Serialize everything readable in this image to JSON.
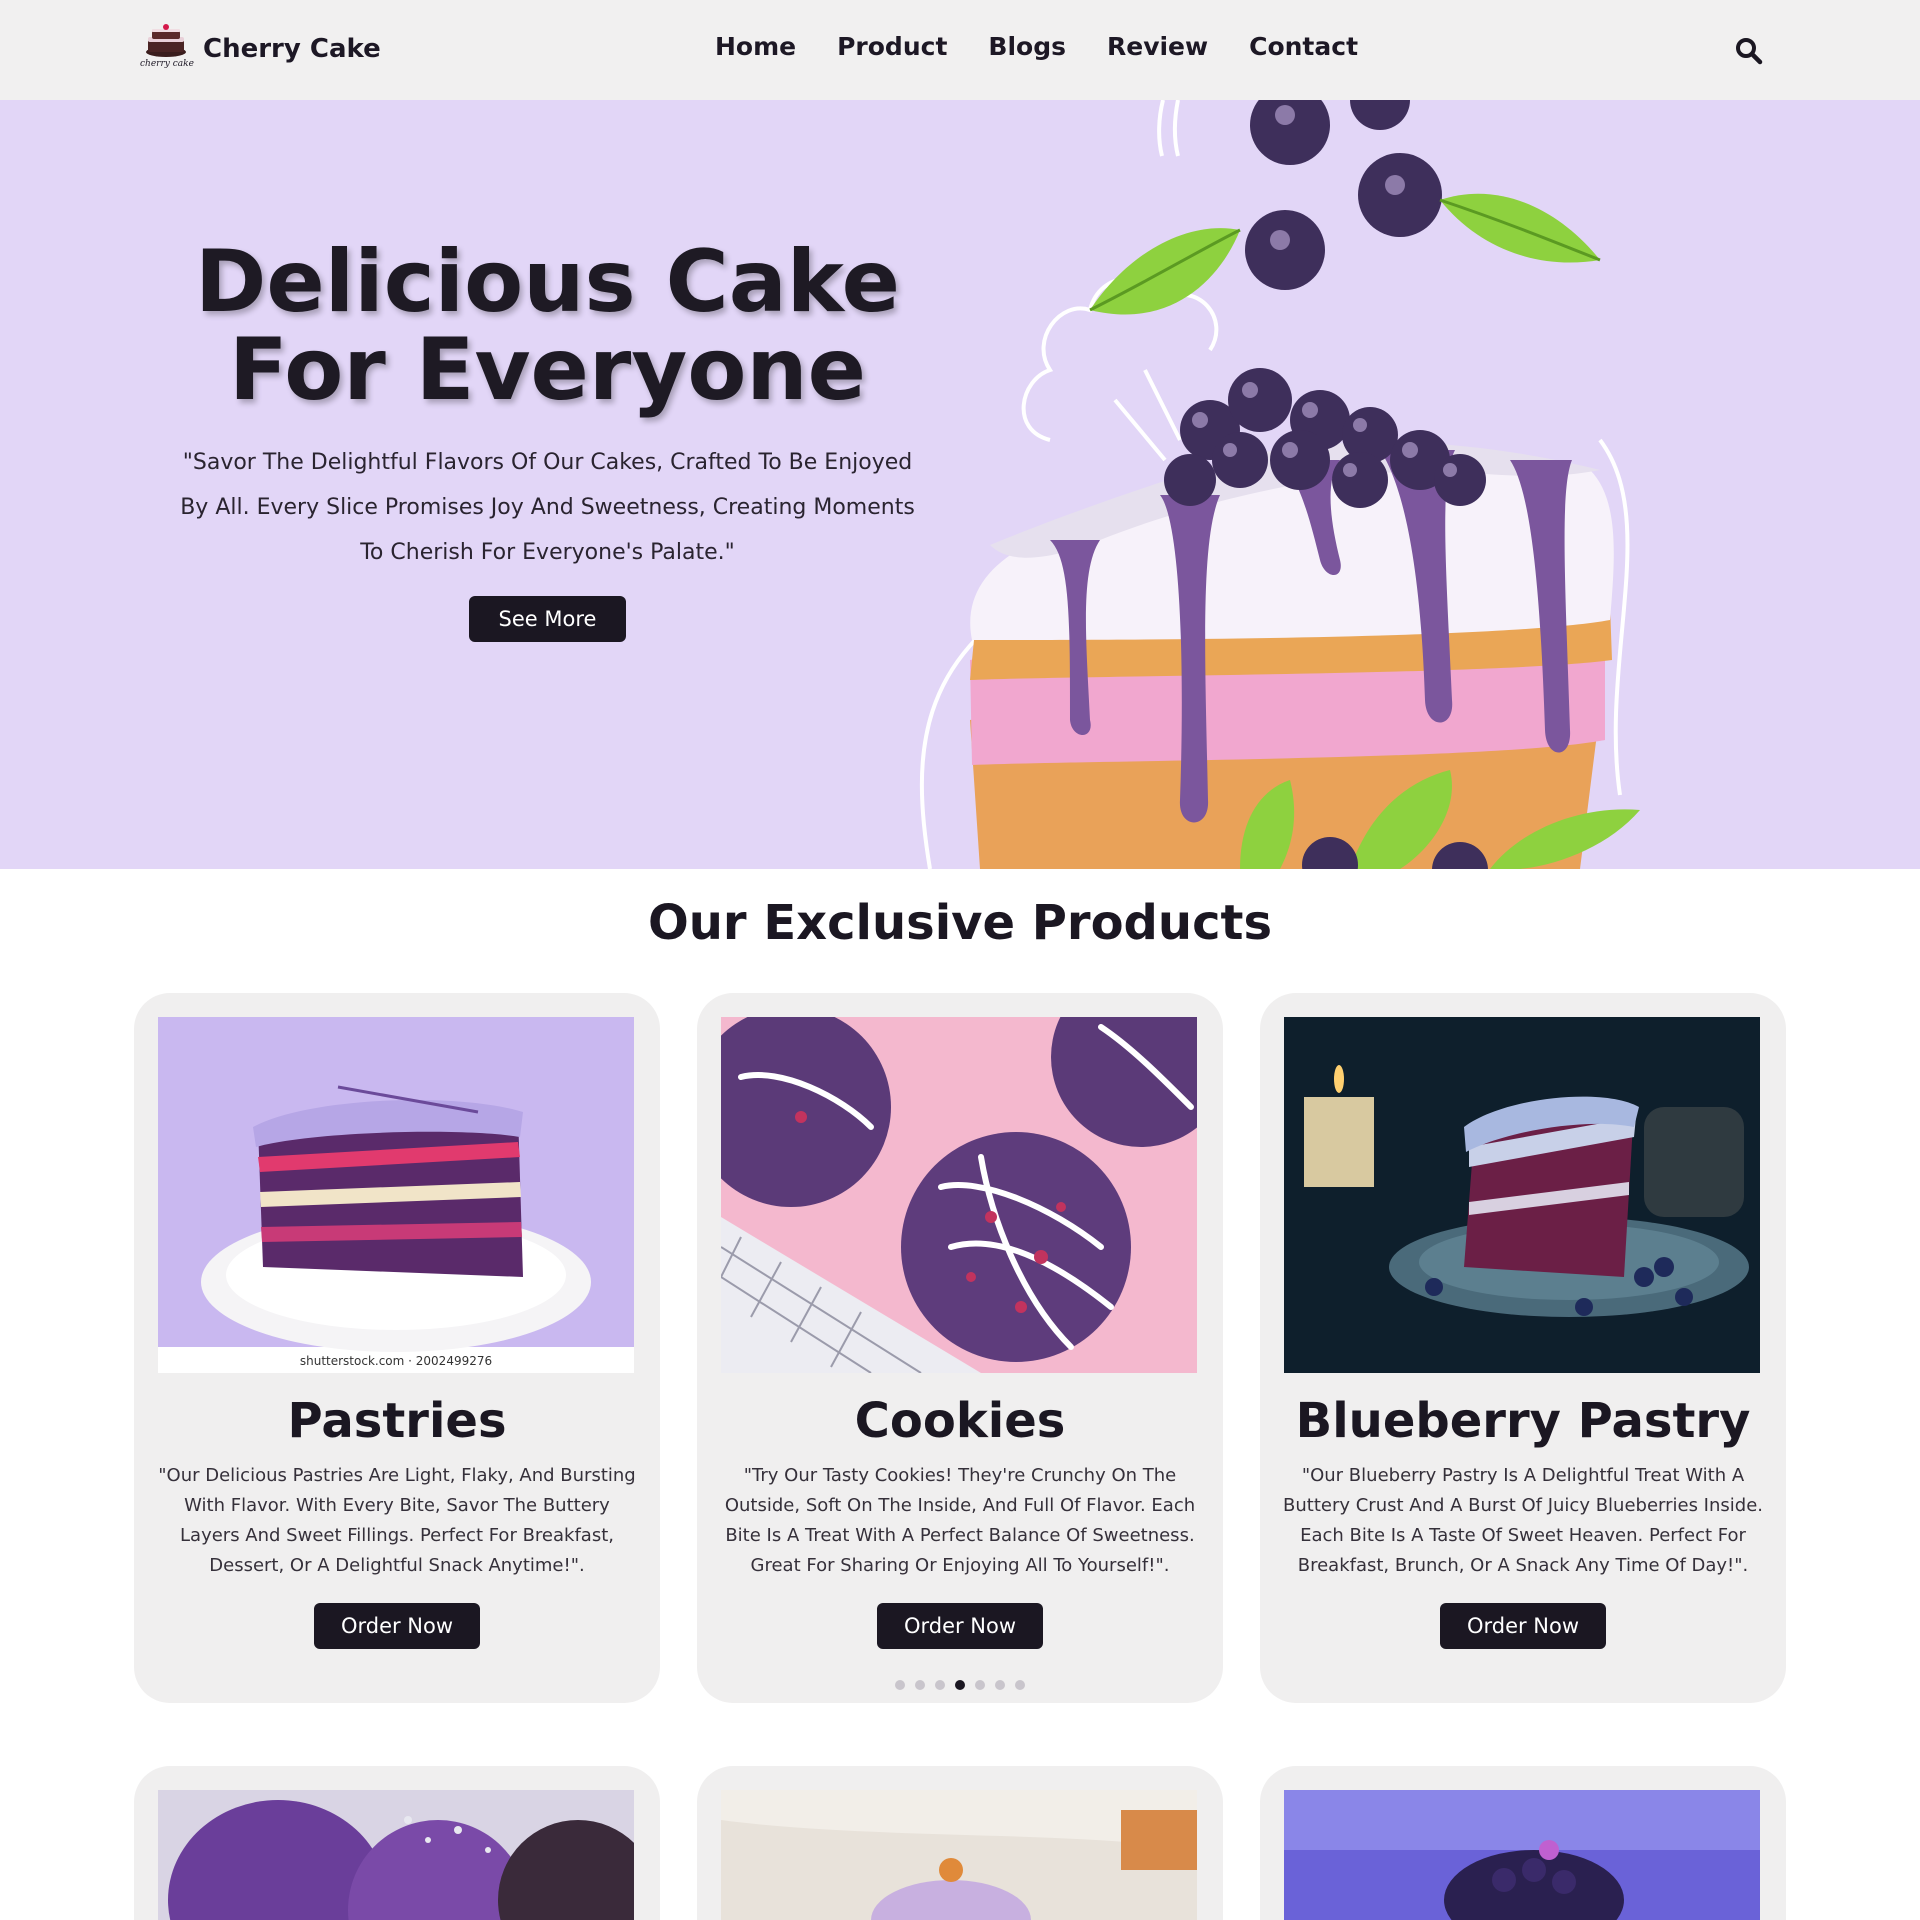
{
  "header": {
    "brand": "Cherry Cake",
    "logo_text": "cherry cake",
    "nav": [
      "Home",
      "Product",
      "Blogs",
      "Review",
      "Contact"
    ]
  },
  "hero": {
    "title_line1": "Delicious Cake",
    "title_line2": "For Everyone",
    "text": "\"Savor The Delightful Flavors Of Our Cakes, Crafted To Be Enjoyed By All. Every Slice Promises Joy And Sweetness, Creating Moments To Cherish For Everyone's Palate.\"",
    "button": "See More"
  },
  "products": {
    "title": "Our Exclusive Products",
    "watermark": "shutterstock.com · 2002499276",
    "items": [
      {
        "name": "Pastries",
        "description": "\"Our Delicious Pastries Are Light, Flaky, And Bursting With Flavor. With Every Bite, Savor The Buttery Layers And Sweet Fillings. Perfect For Breakfast, Dessert, Or A Delightful Snack Anytime!\".",
        "button": "Order Now"
      },
      {
        "name": "Cookies",
        "description": "\"Try Our Tasty Cookies! They're Crunchy On The Outside, Soft On The Inside, And Full Of Flavor. Each Bite Is A Treat With A Perfect Balance Of Sweetness. Great For Sharing Or Enjoying All To Yourself!\".",
        "button": "Order Now"
      },
      {
        "name": "Blueberry Pastry",
        "description": "\"Our Blueberry Pastry Is A Delightful Treat With A Buttery Crust And A Burst Of Juicy Blueberries Inside. Each Bite Is A Taste Of Sweet Heaven. Perfect For Breakfast, Brunch, Or A Snack Any Time Of Day!\".",
        "button": "Order Now"
      }
    ],
    "carousel_active_index": 3,
    "carousel_count": 7
  },
  "colors": {
    "header_bg": "#f1f0f0",
    "hero_bg": "#e2d6f7",
    "dark": "#1b1722",
    "card_bg": "#f0efef",
    "accent_purple": "#6b4a9a"
  },
  "icons": [
    "cake-logo-icon",
    "search-icon"
  ]
}
